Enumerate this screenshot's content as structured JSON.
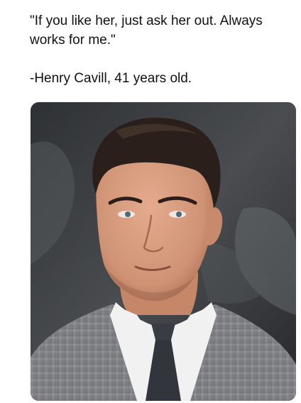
{
  "post": {
    "quote_line1": "\"If you like her, just ask her out. Always",
    "quote_line2": "works for me.\"",
    "attribution": "-Henry Cavill, 41 years old."
  },
  "photo": {
    "subject": "man in grey checked suit, white shirt and dark tie in front of a dark stone backdrop"
  },
  "colors": {
    "background": "#ffffff",
    "text": "#111111",
    "backdrop": "#3a3d40",
    "skin": "#d59a7c",
    "hair": "#2a1f1a",
    "suit": "#8c8d90",
    "tie": "#3a3c44"
  }
}
